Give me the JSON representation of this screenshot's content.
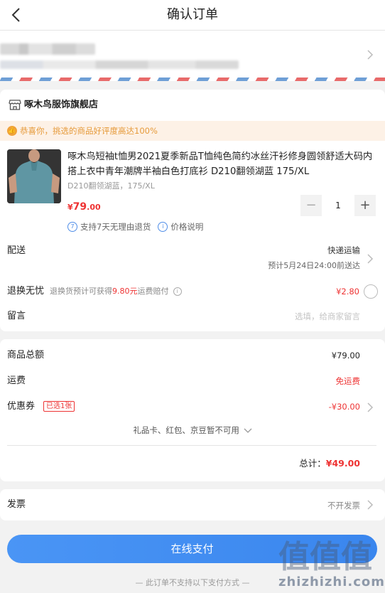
{
  "header": {
    "title": "确认订单"
  },
  "store": {
    "name": "啄木鸟服饰旗舰店",
    "praise_banner": "恭喜你，挑选的商品好评度高达100%"
  },
  "product": {
    "title": "啄木鸟短袖t恤男2021夏季新品T恤纯色简约冰丝汗衫修身圆领舒适大码内搭上衣中青年潮牌半袖白色打底衫 D210翻领湖蓝 175/XL",
    "spec": "D210翻领湖蓝，175/XL",
    "price_symbol": "¥",
    "price_int": "79",
    "price_dec": ".00",
    "quantity": "1",
    "minus": "−",
    "plus": "+",
    "guarantee_badge": "7",
    "guarantee_text": "支持7天无理由退货",
    "price_info_badge": "i",
    "price_info_text": "价格说明"
  },
  "delivery": {
    "label": "配送",
    "method": "快递运输",
    "eta": "预计5月24日24:00前送达"
  },
  "return_service": {
    "label": "退换无忧",
    "desc_prefix": "退换货预计可获得",
    "desc_amount": "9.80元",
    "desc_suffix": "运费赔付",
    "price": "¥2.80"
  },
  "message": {
    "label": "留言",
    "placeholder": "选填，给商家留言"
  },
  "totals": {
    "goods_label": "商品总额",
    "goods_value": "¥79.00",
    "shipping_label": "运费",
    "shipping_value": "免运费",
    "coupon_label": "优惠券",
    "coupon_badge": "已选1张",
    "coupon_value": "-¥30.00",
    "gift_note": "礼品卡、红包、京豆暂不可用",
    "grand_label": "总计：",
    "grand_value": "¥49.00"
  },
  "invoice": {
    "label": "发票",
    "value": "不开发票"
  },
  "pay": {
    "button": "在线支付",
    "notice": "— 此订单不支持以下支付方式 —"
  },
  "watermark": {
    "text": "zhizhizhi.com",
    "glyphs": "值值值"
  },
  "colors": {
    "accent_red": "#e33333",
    "pay_blue": "#3a86ee",
    "praise_orange": "#e69a3a"
  }
}
